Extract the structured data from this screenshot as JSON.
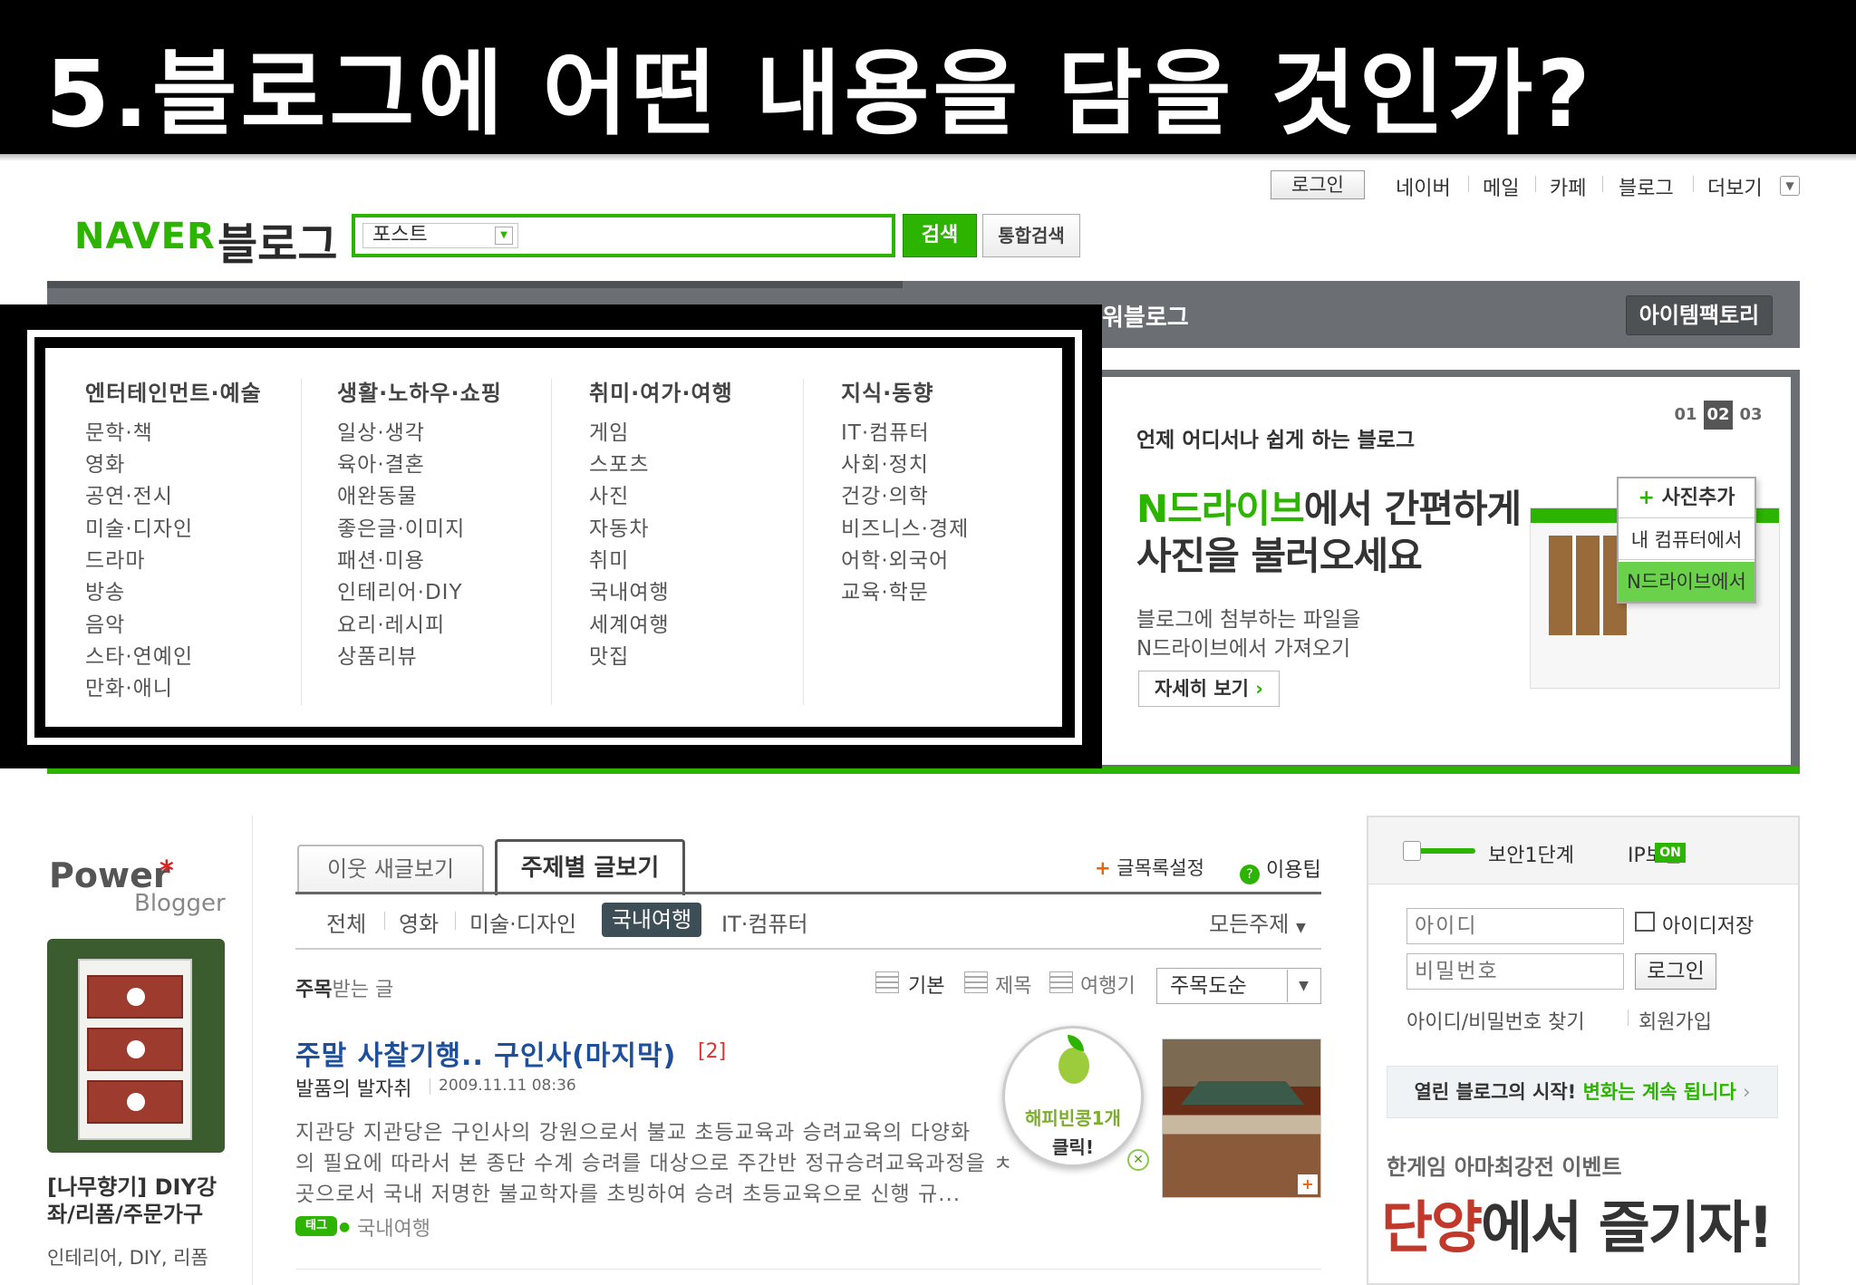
{
  "slide": {
    "title": "5.블로그에 어떤 내용을 담을 것인가?"
  },
  "top_links": {
    "login": "로그인",
    "items": [
      "네이버",
      "메일",
      "카페",
      "블로그",
      "더보기"
    ],
    "more_icon": "chevron-down-icon"
  },
  "logo": {
    "naver": "NAVER",
    "blog": "블로그"
  },
  "search": {
    "scope": "포스트",
    "query": "",
    "search_button": "검색",
    "integrated_button": "통합검색"
  },
  "nav": {
    "partial_label": "워블로그",
    "item_factory": "아이템팩토리"
  },
  "categories": [
    {
      "title": "엔터테인먼트·예술",
      "items": [
        "문학·책",
        "영화",
        "공연·전시",
        "미술·디자인",
        "드라마",
        "방송",
        "음악",
        "스타·연예인",
        "만화·애니"
      ]
    },
    {
      "title": "생활·노하우·쇼핑",
      "items": [
        "일상·생각",
        "육아·결혼",
        "애완동물",
        "좋은글·이미지",
        "패션·미용",
        "인테리어·DIY",
        "요리·레시피",
        "상품리뷰"
      ]
    },
    {
      "title": "취미·여가·여행",
      "items": [
        "게임",
        "스포츠",
        "사진",
        "자동차",
        "취미",
        "국내여행",
        "세계여행",
        "맛집"
      ]
    },
    {
      "title": "지식·동향",
      "items": [
        "IT·컴퓨터",
        "사회·정치",
        "건강·의학",
        "비즈니스·경제",
        "어학·외국어",
        "교육·학문"
      ]
    }
  ],
  "promo": {
    "subtitle": "언제 어디서나 쉽게 하는 블로그",
    "headline_highlight": "N드라이브",
    "headline_rest": "에서 간편하게",
    "headline_line2": "사진을 불러오세요",
    "desc1": "블로그에 첨부하는 파일을",
    "desc2": "N드라이브에서 가져오기",
    "detail_button": "자세히 보기",
    "pages": [
      "01",
      "02",
      "03"
    ],
    "active_page": "02",
    "menu_add": "사진추가",
    "menu_pc": "내 컴퓨터에서",
    "menu_ndrive": "N드라이브에서"
  },
  "power_blogger": {
    "label": "Power",
    "sub": "Blogger",
    "title_line1": "[나무향기] DIY강",
    "title_line2": "좌/리폼/주문가구",
    "tags": "인테리어, DIY, 리폼"
  },
  "tabs": {
    "neighbor": "이웃 새글보기",
    "topic": "주제별 글보기"
  },
  "actions": {
    "list_setting": "글목록설정",
    "usage_tip": "이용팁"
  },
  "subcategories": [
    "전체",
    "영화",
    "미술·디자인",
    "국내여행",
    "IT·컴퓨터"
  ],
  "active_subcategory": "국내여행",
  "all_topics": "모든주제",
  "list_header": {
    "featured_bold": "주목",
    "featured_rest": "받는 글",
    "view_basic": "기본",
    "view_title": "제목",
    "view_summary": "여행기",
    "sort": "주목도순"
  },
  "post": {
    "title": "주말 사찰기행.. 구인사(마지막)",
    "comment_count": "[2]",
    "author": "발품의 발자취",
    "date": "2009.11.11 08:36",
    "excerpt": [
      "지관당 지관당은 구인사의 강원으로서 불교 초등교육과 승려교육의 다양화",
      "의 필요에 따라서 본 종단 수계 승려를 대상으로 주간반 정규승려교육과정을 ㅊ",
      "곳으로서 국내 저명한 불교학자를 초빙하여 승려 초등교육으로 신행 규..."
    ],
    "tag_badge": "태그",
    "tag": "국내여행",
    "bean_line1": "해피빈콩1개",
    "bean_line2": "클릭!"
  },
  "login_panel": {
    "security_level": "보안1단계",
    "ip_security": "IP보안",
    "ip_on": "ON",
    "id_placeholder": "아이디",
    "pw_placeholder": "비밀번호",
    "save_id": "아이디저장",
    "login_button": "로그인",
    "find": "아이디/비밀번호 찾기",
    "join": "회원가입",
    "banner_start": "열린 블로그의 시작! ",
    "banner_highlight": "변화는 계속 됩니다",
    "event_title": "한게임 아마최강전 이벤트",
    "event_big_highlight": "단양",
    "event_big_rest": "에서 즐기자!"
  },
  "colors": {
    "naver_green": "#2db400",
    "nav_gray": "#6b6f73",
    "link_blue": "#1e4f9a"
  }
}
